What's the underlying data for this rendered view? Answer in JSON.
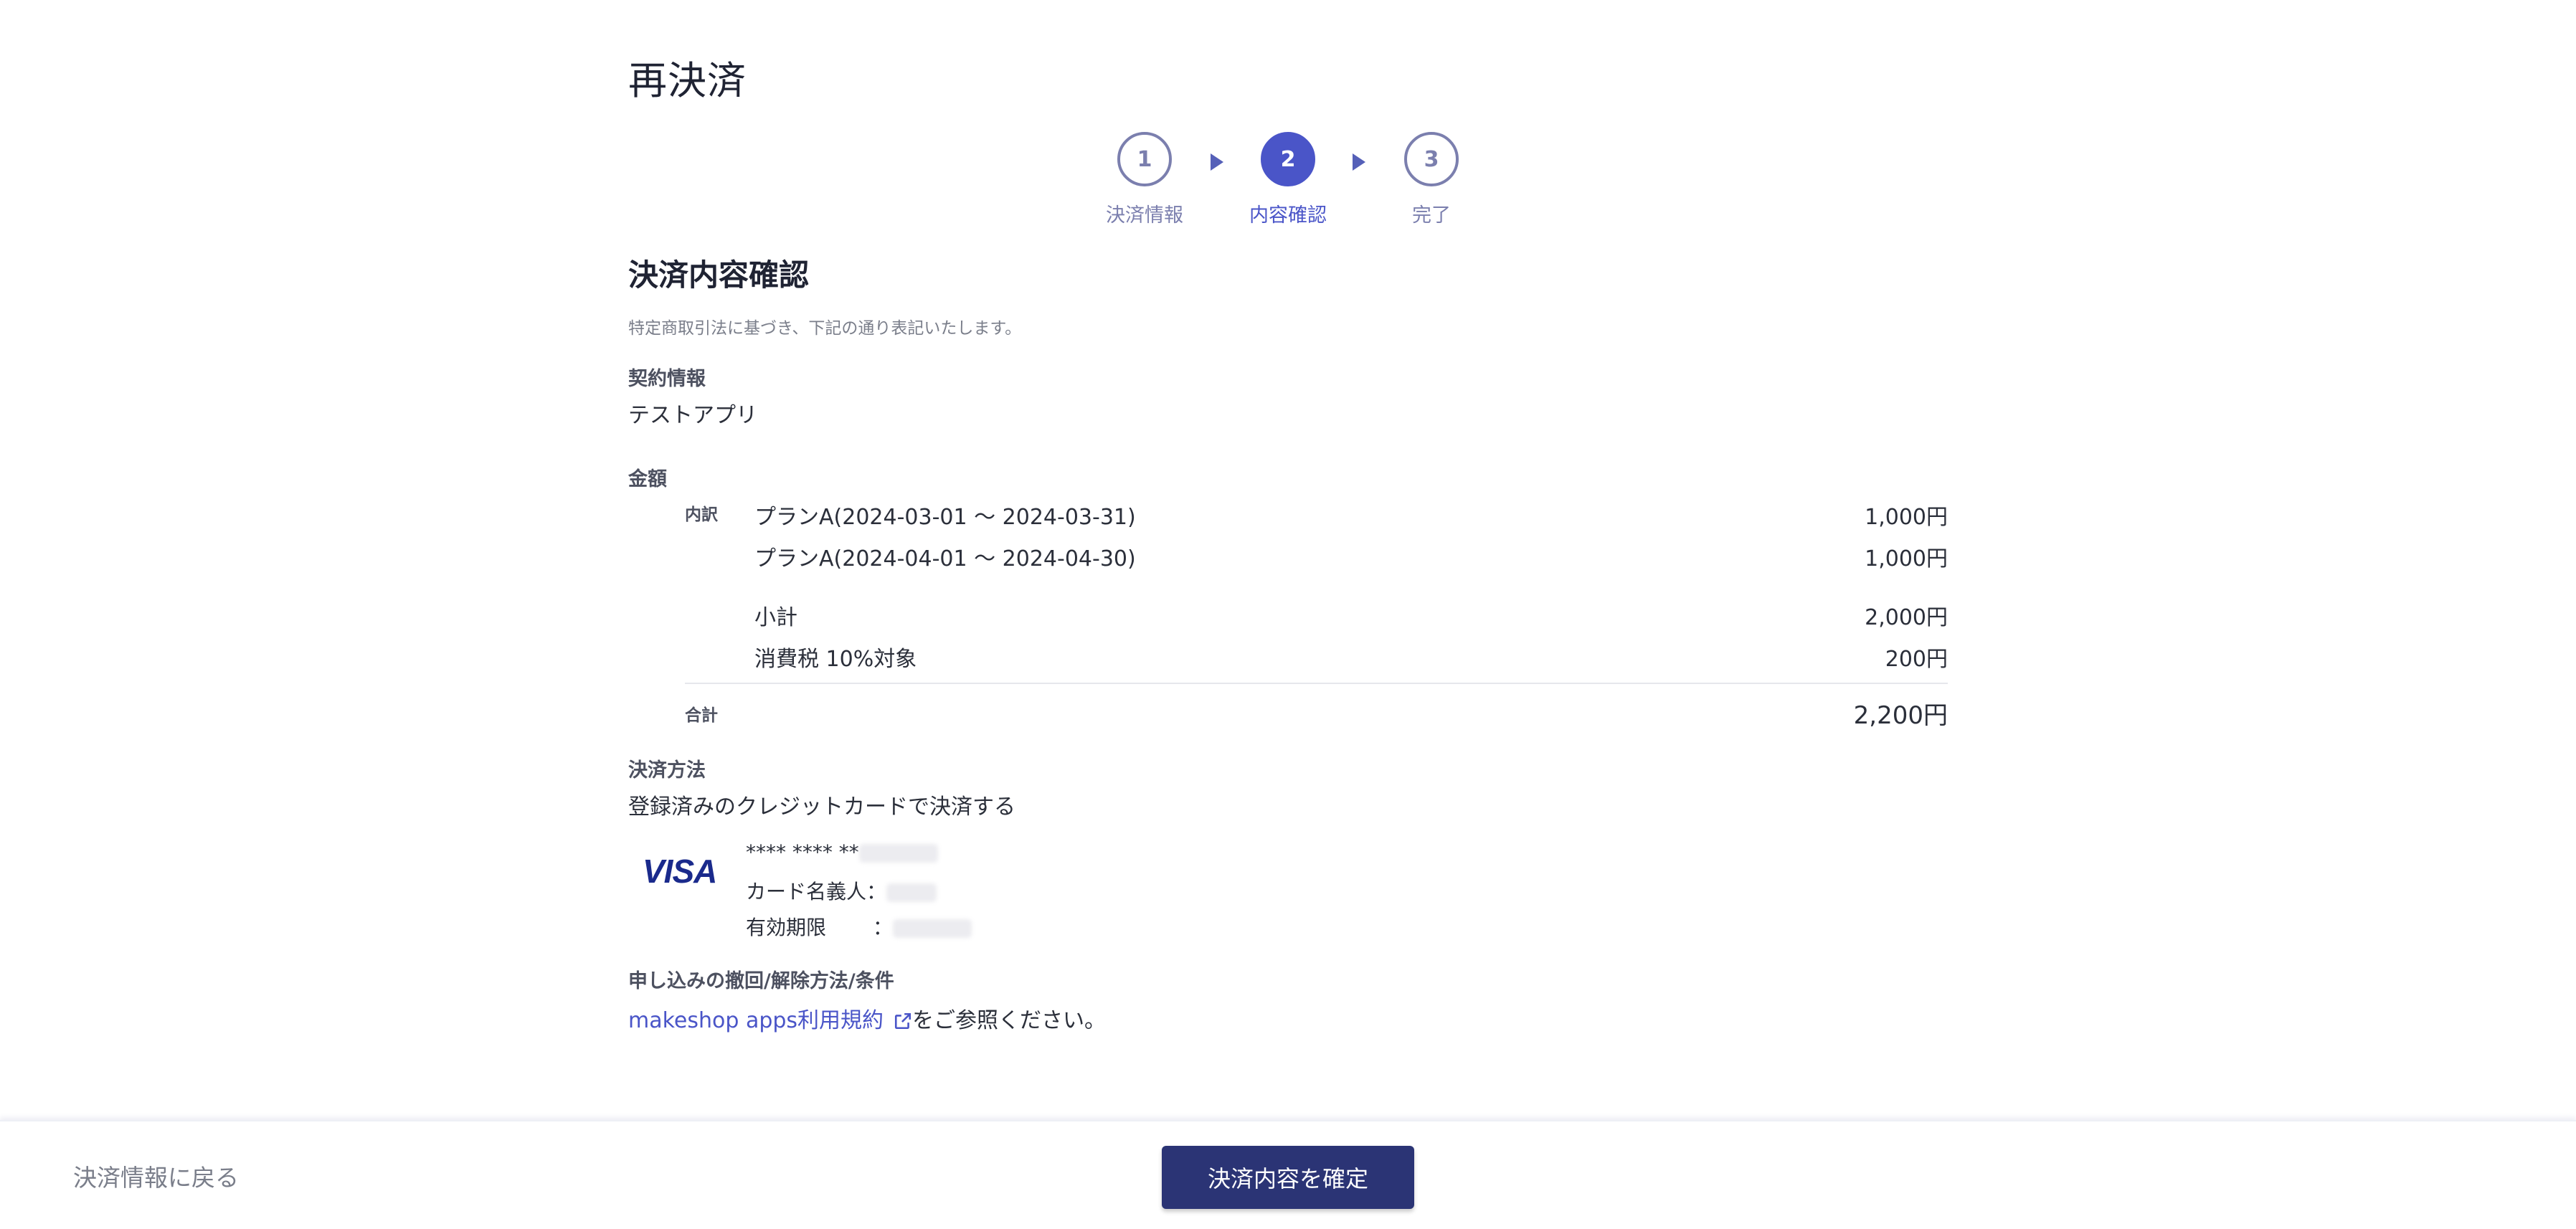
{
  "page": {
    "title": "再決済"
  },
  "stepper": {
    "steps": [
      {
        "number": "1",
        "label": "決済情報"
      },
      {
        "number": "2",
        "label": "内容確認"
      },
      {
        "number": "3",
        "label": "完了"
      }
    ],
    "active_step": 2
  },
  "confirm": {
    "heading": "決済内容確認",
    "lead": "特定商取引法に基づき、下記の通り表記いたします。",
    "contract": {
      "label": "契約情報",
      "value": "テストアプリ"
    },
    "amount": {
      "label": "金額",
      "breakdown_label": "内訳",
      "items": [
        {
          "name": "プランA(2024-03-01 ～ 2024-03-31)",
          "price": "1,000円"
        },
        {
          "name": "プランA(2024-04-01 ～ 2024-04-30)",
          "price": "1,000円"
        }
      ],
      "subtotal_label": "小計",
      "subtotal": "2,000円",
      "tax_label": "消費税 10%対象",
      "tax": "200円",
      "total_label": "合計",
      "total": "2,200円"
    },
    "payment": {
      "label": "決済方法",
      "value": "登録済みのクレジットカードで決済する",
      "card_brand": "VISA",
      "card_number": "**** **** **",
      "holder_label": "カード名義人：",
      "expiry_label": "有効期限 　　："
    },
    "terms": {
      "label": "申し込みの撤回/解除方法/条件",
      "link_text": "makeshop apps利用規約",
      "suffix": "をご参照ください。"
    }
  },
  "footer": {
    "back_label": "決済情報に戻る",
    "confirm_label": "決済内容を確定"
  },
  "colors": {
    "primary": "#4a55c8",
    "button": "#2b3475",
    "muted": "#7b7fae"
  }
}
